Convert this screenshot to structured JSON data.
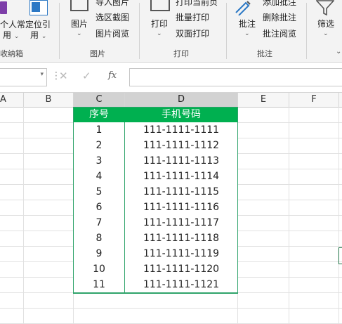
{
  "ribbon": {
    "group1": {
      "btn1": "个人常",
      "btn1b": "用",
      "btn2": "定位引",
      "btn2b": "用",
      "label": "收纳箱"
    },
    "group2": {
      "btn_picture": "图片",
      "small1": "导入图片",
      "small2": "选区截图",
      "small3": "图片阅览",
      "label": "图片"
    },
    "group3": {
      "btn_print": "打印",
      "small1": "打印当前页",
      "small2": "批量打印",
      "small3": "双面打印",
      "label": "打印"
    },
    "group4": {
      "btn_comment": "批注",
      "small1": "添加批注",
      "small2": "删除批注",
      "small3": "批注阅览",
      "label": "批注"
    },
    "group5": {
      "btn_filter": "筛选"
    }
  },
  "formula_bar": {
    "fx_label": "fx",
    "value": ""
  },
  "columns": [
    "A",
    "B",
    "C",
    "D",
    "E",
    "F"
  ],
  "table": {
    "headers": [
      "序号",
      "手机号码"
    ],
    "rows": [
      [
        "1",
        "111-1111-1111"
      ],
      [
        "2",
        "111-1111-1112"
      ],
      [
        "3",
        "111-1111-1113"
      ],
      [
        "4",
        "111-1111-1114"
      ],
      [
        "5",
        "111-1111-1115"
      ],
      [
        "6",
        "111-1111-1116"
      ],
      [
        "7",
        "111-1111-1117"
      ],
      [
        "8",
        "111-1111-1118"
      ],
      [
        "9",
        "111-1111-1119"
      ],
      [
        "10",
        "111-1111-1120"
      ],
      [
        "11",
        "111-1111-1121"
      ]
    ]
  },
  "colors": {
    "header_fill": "#00b050",
    "table_border": "#2ea36a",
    "header_text": "#ffffff"
  }
}
